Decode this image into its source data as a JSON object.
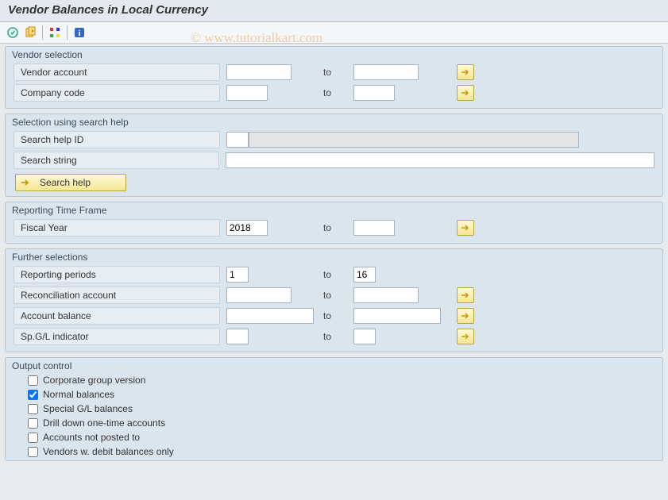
{
  "window": {
    "title": "Vendor Balances in Local Currency",
    "watermark": "© www.tutorialkart.com"
  },
  "groups": {
    "vendor_selection": {
      "title": "Vendor selection",
      "vendor_account": {
        "label": "Vendor account",
        "from": "",
        "to": ""
      },
      "company_code": {
        "label": "Company code",
        "from": "",
        "to": ""
      }
    },
    "search_help": {
      "title": "Selection using search help",
      "search_help_id": {
        "label": "Search help ID",
        "value": ""
      },
      "search_string": {
        "label": "Search string",
        "value": ""
      },
      "button_label": "Search help"
    },
    "reporting_time": {
      "title": "Reporting Time Frame",
      "fiscal_year": {
        "label": "Fiscal Year",
        "from": "2018",
        "to": ""
      }
    },
    "further": {
      "title": "Further selections",
      "reporting_periods": {
        "label": "Reporting periods",
        "from": "1",
        "to": "16"
      },
      "reconciliation": {
        "label": "Reconciliation account",
        "from": "",
        "to": ""
      },
      "account_balance": {
        "label": "Account balance",
        "from": "",
        "to": ""
      },
      "sp_gl": {
        "label": "Sp.G/L indicator",
        "from": "",
        "to": ""
      }
    },
    "output": {
      "title": "Output control",
      "items": [
        {
          "label": "Corporate group version",
          "checked": false
        },
        {
          "label": "Normal balances",
          "checked": true
        },
        {
          "label": "Special G/L balances",
          "checked": false
        },
        {
          "label": "Drill down one-time accounts",
          "checked": false
        },
        {
          "label": "Accounts not posted to",
          "checked": false
        },
        {
          "label": "Vendors w. debit balances only",
          "checked": false
        }
      ]
    }
  },
  "common": {
    "to_label": "to"
  }
}
